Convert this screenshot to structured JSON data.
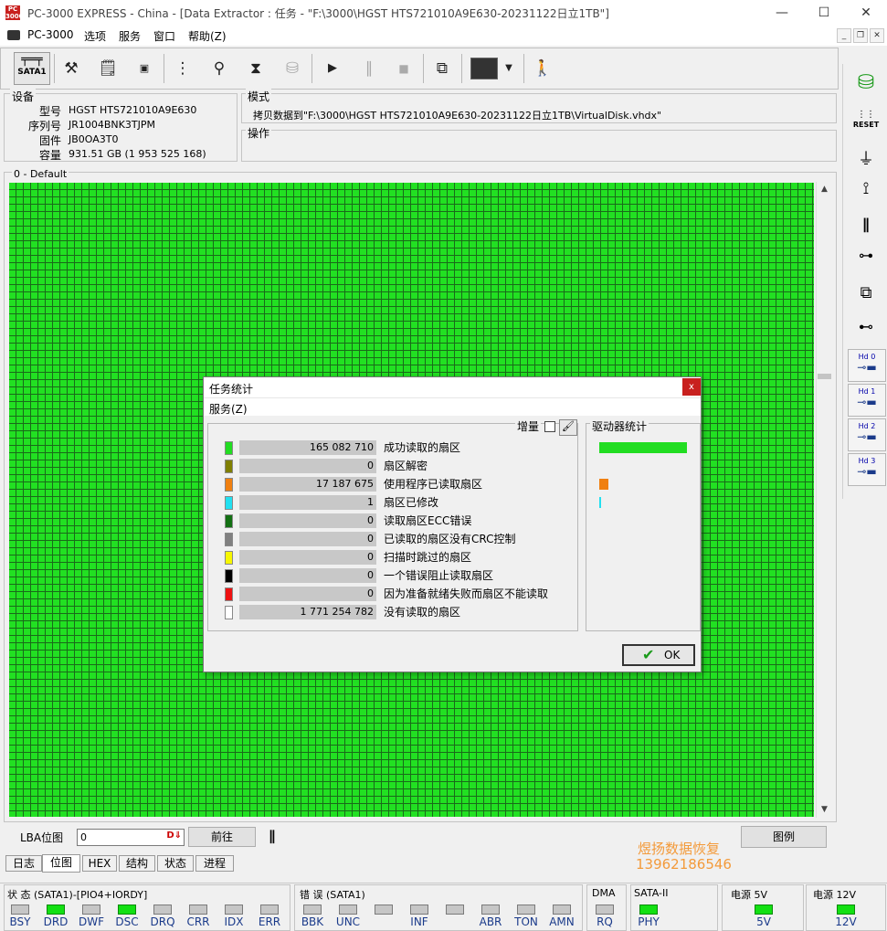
{
  "window": {
    "title": "PC-3000 EXPRESS - China - [Data Extractor : 任务 - \"F:\\3000\\HGST HTS721010A9E630-20231122日立1TB\"]",
    "app_icon_text": "PC\n3000"
  },
  "menu": {
    "items": [
      "PC-3000",
      "选项",
      "服务",
      "窗口",
      "帮助(Z)"
    ]
  },
  "toolbar": {
    "sata_label": "SATA1"
  },
  "device": {
    "group_label": "设备",
    "model_label": "型号",
    "model_value": "HGST HTS721010A9E630",
    "serial_label": "序列号",
    "serial_value": "JR1004BNK3TJPM",
    "firmware_label": "固件",
    "firmware_value": "JB0OA3T0",
    "capacity_label": "容量",
    "capacity_value": "931.51 GB (1 953 525 168)"
  },
  "mode": {
    "group_label": "模式",
    "text": "拷贝数据到\"F:\\3000\\HGST HTS721010A9E630-20231122日立1TB\\VirtualDisk.vhdx\""
  },
  "operation": {
    "group_label": "操作"
  },
  "map": {
    "group_label": "0 - Default",
    "lba_label": "LBA位图",
    "lba_value": "0",
    "go_button": "前往",
    "pause_icon": "pause-icon",
    "legend_button": "图例"
  },
  "dialog": {
    "title": "任务统计",
    "menu": "服务(Z)",
    "incremental_label": "增量",
    "drive_stats_label": "驱动器统计",
    "ok_label": "OK",
    "rows": [
      {
        "color": "#22dd22",
        "value": "165 082 710",
        "label": "成功读取的扇区"
      },
      {
        "color": "#7f7f00",
        "value": "0",
        "label": "扇区解密"
      },
      {
        "color": "#f08010",
        "value": "17 187 675",
        "label": "使用程序已读取扇区"
      },
      {
        "color": "#22e0f0",
        "value": "1",
        "label": "扇区已修改"
      },
      {
        "color": "#137013",
        "value": "0",
        "label": "读取扇区ECC错误"
      },
      {
        "color": "#808080",
        "value": "0",
        "label": "已读取的扇区没有CRC控制"
      },
      {
        "color": "#f7f700",
        "value": "0",
        "label": "扫描时跳过的扇区"
      },
      {
        "color": "#000000",
        "value": "0",
        "label": "一个错误阻止读取扇区"
      },
      {
        "color": "#ee1111",
        "value": "0",
        "label": "因为准备就绪失败而扇区不能读取"
      },
      {
        "color": "#ffffff",
        "value": "1 771 254 782",
        "label": "没有读取的扇区"
      }
    ],
    "drive_bars": [
      {
        "color": "#22dd22",
        "fraction": 1.0
      },
      {
        "color": "#f08010",
        "fraction": 0.1
      },
      {
        "color": "#22e0f0",
        "fraction": 0.02
      }
    ]
  },
  "tabs": [
    "日志",
    "位图",
    "HEX",
    "结构",
    "状态",
    "进程"
  ],
  "active_tab": "位图",
  "watermark": {
    "line1": "煜扬数据恢复",
    "line2": "13962186546"
  },
  "status": {
    "state_label": "状 态 (SATA1)-[PIO4+IORDY]",
    "state_leds": [
      {
        "name": "BSY",
        "on": false
      },
      {
        "name": "DRD",
        "on": true
      },
      {
        "name": "DWF",
        "on": false
      },
      {
        "name": "DSC",
        "on": true
      },
      {
        "name": "DRQ",
        "on": false
      },
      {
        "name": "CRR",
        "on": false
      },
      {
        "name": "IDX",
        "on": false
      },
      {
        "name": "ERR",
        "on": false
      }
    ],
    "error_label": "错 误 (SATA1)",
    "error_leds": [
      {
        "name": "BBK",
        "on": false
      },
      {
        "name": "UNC",
        "on": false
      },
      {
        "name": "",
        "on": false
      },
      {
        "name": "INF",
        "on": false
      },
      {
        "name": "",
        "on": false
      },
      {
        "name": "ABR",
        "on": false
      },
      {
        "name": "TON",
        "on": false
      },
      {
        "name": "AMN",
        "on": false
      }
    ],
    "dma_label": "DMA",
    "dma_led": {
      "name": "RQ",
      "on": false
    },
    "sata_label": "SATA-II",
    "sata_led": {
      "name": "PHY",
      "on": true
    },
    "power5_label": "电源 5V",
    "power5_led": {
      "name": "5V",
      "on": true
    },
    "power12_label": "电源 12V",
    "power12_led": {
      "name": "12V",
      "on": true
    }
  },
  "right_panel": {
    "reset_label": "RESET",
    "hd_buttons": [
      "Hd 0",
      "Hd 1",
      "Hd 2",
      "Hd 3"
    ]
  }
}
